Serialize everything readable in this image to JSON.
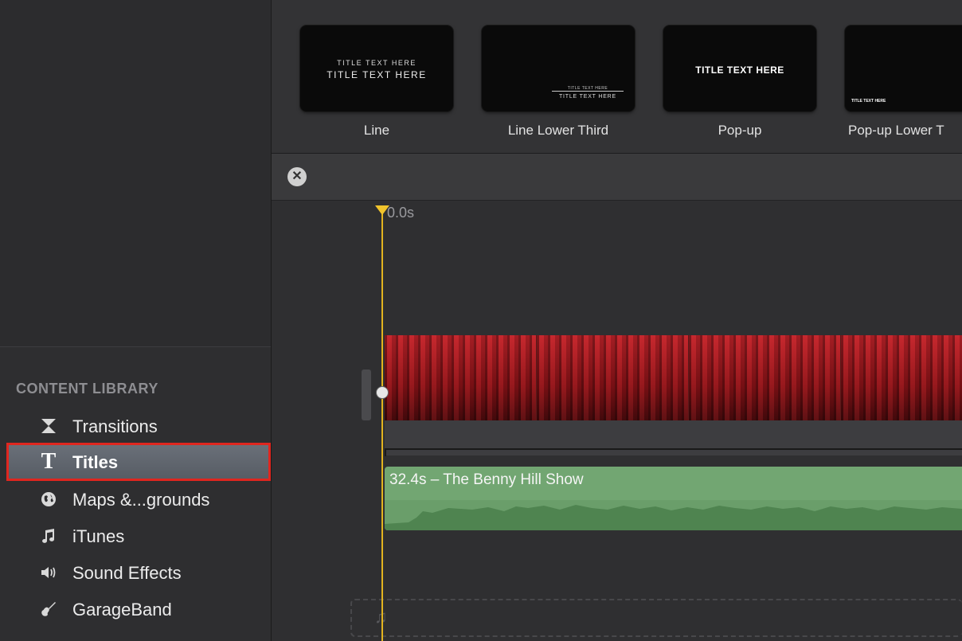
{
  "sidebar": {
    "header": "CONTENT LIBRARY",
    "items": [
      {
        "label": "Transitions",
        "icon": "transitions-icon"
      },
      {
        "label": "Titles",
        "icon": "title-t-icon"
      },
      {
        "label": "Maps &...grounds",
        "icon": "globe-icon"
      },
      {
        "label": "iTunes",
        "icon": "music-note-icon"
      },
      {
        "label": "Sound Effects",
        "icon": "speaker-icon"
      },
      {
        "label": "GarageBand",
        "icon": "guitar-icon"
      }
    ],
    "selected": "Titles"
  },
  "browser": {
    "titles": [
      {
        "caption": "Line",
        "preview_lines": [
          "TITLE TEXT HERE",
          "TITLE TEXT HERE"
        ]
      },
      {
        "caption": "Line Lower Third",
        "preview_lines": [
          "TITLE TEXT HERE",
          "TITLE TEXT HERE"
        ]
      },
      {
        "caption": "Pop-up",
        "preview_lines": [
          "TITLE TEXT HERE"
        ]
      },
      {
        "caption": "Pop-up Lower T",
        "preview_lines": [
          "TITLE TEXT HERE"
        ]
      }
    ]
  },
  "timeline": {
    "close_icon": "close-circle-icon",
    "playhead_time": "0.0s",
    "audio_clip_label": "32.4s – The Benny Hill Show",
    "colors": {
      "playhead": "#e3b41f",
      "audio_clip": "#72a672",
      "video_clip": "#a01b21",
      "selection_outline": "#e0261f"
    }
  }
}
